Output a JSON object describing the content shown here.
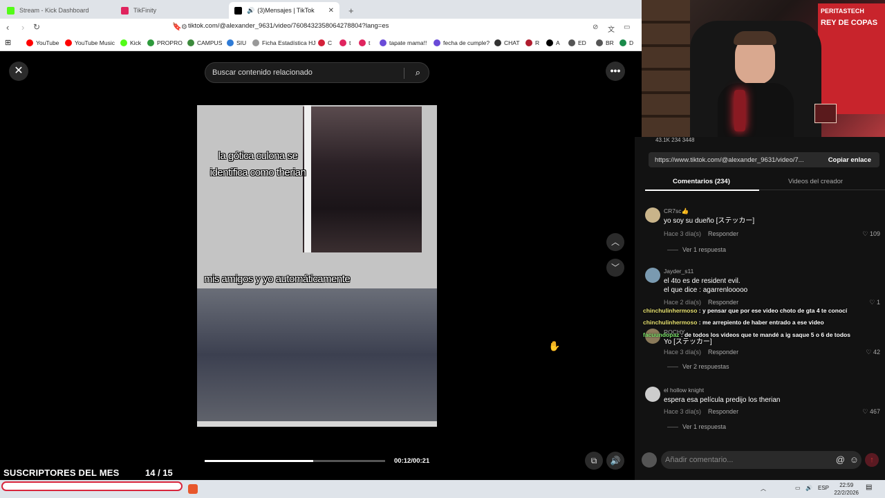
{
  "browser": {
    "tabs": [
      {
        "label": "Stream - Kick Dashboard",
        "color": "#53fc18"
      },
      {
        "label": "TikFinity",
        "color": "#e0245e"
      },
      {
        "label": "(3)Mensajes | TikTok",
        "color": "#000000"
      }
    ],
    "url": "tiktok.com/@alexander_9631/video/7608432358064278804?lang=es",
    "bookmarks": [
      {
        "label": "YouTube",
        "color": "#ff0000"
      },
      {
        "label": "YouTube Music",
        "color": "#ff0000"
      },
      {
        "label": "Kick",
        "color": "#53fc18"
      },
      {
        "label": "PROPRO",
        "color": "#2e9a3c"
      },
      {
        "label": "CAMPUS",
        "color": "#3c8a3c"
      },
      {
        "label": "SIU",
        "color": "#2f7bd6"
      },
      {
        "label": "Ficha Estadística HJ",
        "color": "#999999"
      },
      {
        "label": "C",
        "color": "#d4213a"
      },
      {
        "label": "t",
        "color": "#e0245e"
      },
      {
        "label": "t",
        "color": "#e0245e"
      },
      {
        "label": "tapate mama!!",
        "color": "#6a4bd8"
      },
      {
        "label": "fecha de cumple?",
        "color": "#6a4bd8"
      },
      {
        "label": "CHAT",
        "color": "#333333"
      },
      {
        "label": "R",
        "color": "#b01c2e"
      },
      {
        "label": "A",
        "color": "#000000"
      },
      {
        "label": "ED",
        "color": "#555555"
      },
      {
        "label": "BR",
        "color": "#555555"
      },
      {
        "label": "D",
        "color": "#1a8a4a"
      }
    ]
  },
  "video": {
    "search_placeholder": "Buscar contenido relacionado",
    "caption_top": "la gótica culona se identifica como therian",
    "caption_mid": "mis amigos y yo automáticamente",
    "time": "00:12/00:21",
    "progress": 0.6
  },
  "panel": {
    "stats": "43.1K    234    3448",
    "link": "https://www.tiktok.com/@alexander_9631/video/7...",
    "copy_label": "Copiar enlace",
    "tab_comments": "Comentarios (234)",
    "tab_creator": "Videos del creador",
    "comments": [
      {
        "user": "CR7sc👍",
        "text": "yo soy su dueño [ステッカー]",
        "meta": "Hace 3 día(s)",
        "reply": "Responder",
        "likes": "109",
        "more": "Ver 1 respuesta",
        "color": "#c9b48a"
      },
      {
        "user": "Jayder_s11",
        "text": "el 4to es de resident evil.\nel que dice : agarrenlooooo",
        "meta": "Hace 2 día(s)",
        "reply": "Responder",
        "likes": "1",
        "more": "",
        "color": "#7a9ab0"
      },
      {
        "user": "ROCHY",
        "text": "Yo [ステッカー]",
        "meta": "Hace 3 día(s)",
        "reply": "Responder",
        "likes": "42",
        "more": "Ver 2 respuestas",
        "color": "#8a7a5a"
      },
      {
        "user": "el hollow knight",
        "text": "espera esa película predijo los therian",
        "meta": "Hace 3 día(s)",
        "reply": "Responder",
        "likes": "467",
        "more": "Ver 1 respuesta",
        "color": "#cccccc"
      }
    ],
    "comment_placeholder": "Añadir comentario..."
  },
  "chat": [
    {
      "user": "chinchulinhermoso",
      "msg": ": y pensar que por ese video choto de gta 4 te conocí"
    },
    {
      "user": "chinchulinhermoso",
      "msg": ": me arrepiento de haber entrado a ese video"
    },
    {
      "user": "facuundopaz",
      "msg": ": de todos los videos que te mandé a ig saque 5 o 6 de todos"
    }
  ],
  "overlay": {
    "subs_label": "SUSCRIPTORES DEL MES",
    "subs_count": "14  / 15",
    "subs_progress": 0.93
  },
  "webcam": {
    "flag_line1": "PERITASTECH",
    "flag_line2": "REY DE COPAS"
  },
  "taskbar": {
    "lang": "ESP",
    "time": "22:59",
    "date": "22/2/2026"
  }
}
